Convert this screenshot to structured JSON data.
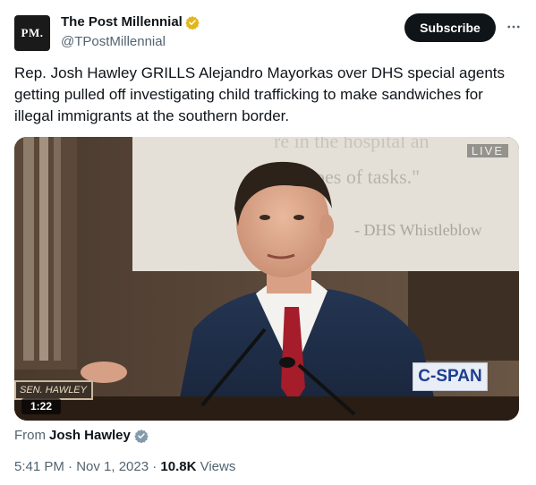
{
  "account": {
    "avatar_text": "PM.",
    "display_name": "The Post Millennial",
    "handle": "@TPostMillennial",
    "verified_color": "#e2b719"
  },
  "actions": {
    "subscribe_label": "Subscribe",
    "more_icon": "more-horizontal-icon"
  },
  "tweet": {
    "text": "Rep. Josh Hawley GRILLS Alejandro Mayorkas over DHS special agents getting pulled off investigating child trafficking to make sandwiches for illegal immigrants at the southern border."
  },
  "video": {
    "screen_text_1": "re in the hospital an",
    "screen_text_2": "ypes of tasks.\"",
    "screen_text_3": "- DHS Whistleblow",
    "live_label": "LIVE",
    "network_label": "C-SPAN",
    "nameplate": "SEN. HAWLEY",
    "duration": "1:22"
  },
  "source": {
    "from_label": "From",
    "from_name": "Josh Hawley"
  },
  "meta": {
    "time": "5:41 PM · Nov 1, 2023 · ",
    "views_count": "10.8K",
    "views_label": " Views"
  }
}
